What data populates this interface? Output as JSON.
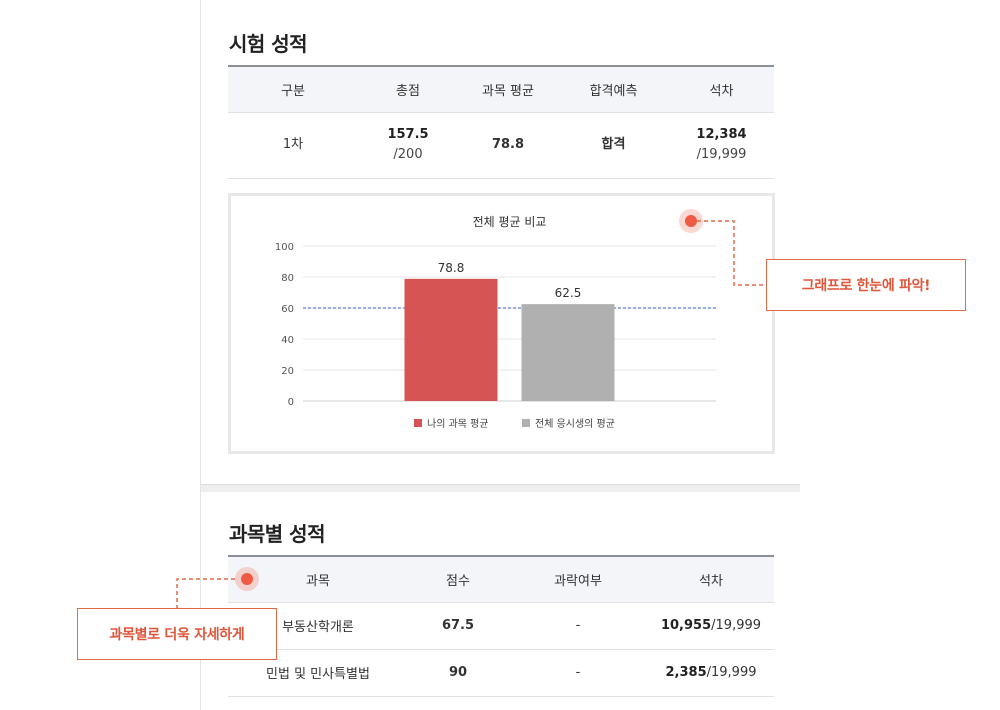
{
  "exam_section": {
    "title": "시험 성적",
    "headers": [
      "구분",
      "총점",
      "과목 평균",
      "합격예측",
      "석차"
    ],
    "row": {
      "round": "1차",
      "total_score": "157.5",
      "total_max": "/200",
      "subject_average": "78.8",
      "prediction": "합격",
      "rank": "12,384",
      "rank_total": "/19,999"
    }
  },
  "chart_data": {
    "type": "bar",
    "title": "전체 평균 비교",
    "series": [
      {
        "name": "나의 과목 평균",
        "value": 78.8,
        "label": "78.8",
        "color": "#d65454"
      },
      {
        "name": "전체 응시생의 평균",
        "value": 62.5,
        "label": "62.5",
        "color": "#b0b0b0"
      }
    ],
    "ylim": [
      0,
      100
    ],
    "yticks": [
      "0",
      "20",
      "40",
      "60",
      "80",
      "100"
    ],
    "reference_line": {
      "value": 60,
      "style": "dashed",
      "color": "#3a5fc8"
    },
    "grid": true,
    "legend": "bottom"
  },
  "subject_section": {
    "title": "과목별 성적",
    "headers": [
      "과목",
      "점수",
      "과락여부",
      "석차"
    ],
    "rows": [
      {
        "subject": "부동산학개론",
        "score": "67.5",
        "fail": "-",
        "rank": "10,955",
        "rank_total": "/19,999"
      },
      {
        "subject": "민법 및 민사특별법",
        "score": "90",
        "fail": "-",
        "rank": "2,385",
        "rank_total": "/19,999"
      }
    ]
  },
  "callouts": {
    "graph": "그래프로 한눈에 파악!",
    "subject": "과목별로 더욱 자세하게"
  },
  "colors": {
    "accent": "#e0563a",
    "pass": "#2c5cc5",
    "my_bar": "#d65454",
    "avg_bar": "#b0b0b0"
  }
}
